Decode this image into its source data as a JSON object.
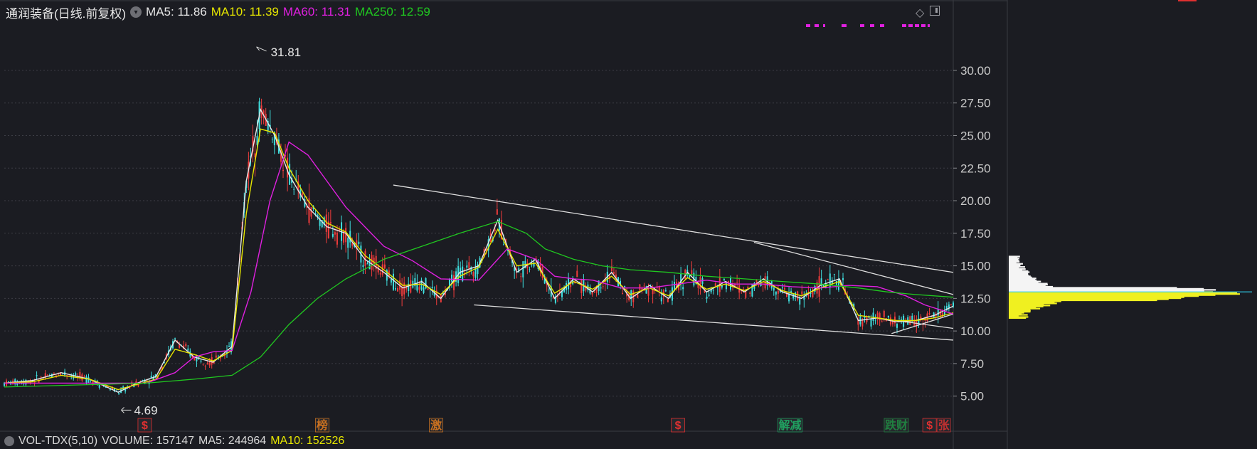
{
  "header": {
    "stock_name": "通润装备(日线.前复权)",
    "ma5": "MA5: 11.86",
    "ma10": "MA10: 11.39",
    "ma60": "MA60: 11.31",
    "ma250": "MA250: 12.59"
  },
  "volume_bar": {
    "label": "VOL-TDX(5,10)",
    "volume": "VOLUME: 157147",
    "ma5": "MA5: 244964",
    "ma10": "MA10: 152526"
  },
  "colors": {
    "background": "#1b1c22",
    "ma5": "#e8e8e8",
    "ma10": "#e6e600",
    "ma60": "#e020e0",
    "ma250": "#20c820",
    "up_candle": "#f03c3c",
    "down_candle": "#40e0e0"
  },
  "chart_data": {
    "type": "line",
    "title": "通润装备(日线.前复权)",
    "y_axis": {
      "ticks": [
        "30.00",
        "27.50",
        "25.00",
        "22.50",
        "20.00",
        "17.50",
        "15.00",
        "12.50",
        "10.00",
        "7.50",
        "5.00"
      ],
      "tick_values": [
        30,
        27.5,
        25,
        22.5,
        20,
        17.5,
        15,
        12.5,
        10,
        7.5,
        5
      ],
      "ylim": [
        4.0,
        33.0
      ],
      "position": "right",
      "grid": true
    },
    "annotations": [
      {
        "text": "31.81",
        "x": 0.2658,
        "value": 31.81,
        "kind": "high"
      },
      {
        "text": "4.69",
        "x": 0.1233,
        "value": 4.69,
        "kind": "low"
      }
    ],
    "x_range": [
      0,
      1
    ],
    "series": [
      {
        "name": "MA5",
        "color": "#e8e8e8",
        "x": [
          0,
          0.03,
          0.06,
          0.09,
          0.12,
          0.14,
          0.16,
          0.18,
          0.2,
          0.22,
          0.24,
          0.255,
          0.27,
          0.285,
          0.3,
          0.32,
          0.34,
          0.36,
          0.38,
          0.4,
          0.42,
          0.44,
          0.46,
          0.48,
          0.5,
          0.52,
          0.54,
          0.56,
          0.58,
          0.6,
          0.62,
          0.64,
          0.66,
          0.68,
          0.7,
          0.72,
          0.74,
          0.76,
          0.78,
          0.8,
          0.82,
          0.84,
          0.86,
          0.88,
          0.9,
          0.92,
          0.94,
          0.96,
          0.98,
          1.0
        ],
        "y": [
          6.0,
          6.2,
          6.8,
          6.3,
          5.3,
          6.0,
          6.5,
          9.3,
          8.0,
          7.6,
          8.8,
          21.5,
          27.0,
          25.0,
          22.0,
          19.5,
          18.0,
          17.5,
          15.5,
          14.5,
          13.3,
          13.8,
          12.5,
          14.5,
          15.0,
          18.5,
          14.5,
          15.5,
          12.5,
          14.0,
          13.0,
          14.5,
          12.5,
          13.5,
          12.5,
          14.5,
          13.0,
          13.8,
          13.0,
          14.0,
          13.0,
          12.5,
          13.5,
          14.0,
          10.8,
          11.0,
          10.7,
          10.8,
          11.2,
          11.9
        ]
      },
      {
        "name": "MA10",
        "color": "#e6e600",
        "x": [
          0,
          0.03,
          0.06,
          0.09,
          0.12,
          0.14,
          0.16,
          0.18,
          0.2,
          0.22,
          0.24,
          0.255,
          0.27,
          0.285,
          0.3,
          0.32,
          0.34,
          0.36,
          0.38,
          0.4,
          0.42,
          0.44,
          0.46,
          0.48,
          0.5,
          0.52,
          0.54,
          0.56,
          0.58,
          0.6,
          0.62,
          0.64,
          0.66,
          0.68,
          0.7,
          0.72,
          0.74,
          0.76,
          0.78,
          0.8,
          0.82,
          0.84,
          0.86,
          0.88,
          0.9,
          0.92,
          0.94,
          0.96,
          0.98,
          1.0
        ],
        "y": [
          6.0,
          6.1,
          6.6,
          6.3,
          5.5,
          5.9,
          6.3,
          8.6,
          8.2,
          7.7,
          8.5,
          19.0,
          25.5,
          25.2,
          22.5,
          20.0,
          18.3,
          17.6,
          15.8,
          14.7,
          13.5,
          13.6,
          12.8,
          14.2,
          14.9,
          17.8,
          15.0,
          15.2,
          12.9,
          13.8,
          13.2,
          14.2,
          12.8,
          13.3,
          12.7,
          14.1,
          13.2,
          13.6,
          13.1,
          13.8,
          13.1,
          12.7,
          13.3,
          13.8,
          11.2,
          11.0,
          10.8,
          10.8,
          11.0,
          11.4
        ]
      },
      {
        "name": "MA60",
        "color": "#e020e0",
        "x": [
          0,
          0.1,
          0.15,
          0.18,
          0.2,
          0.22,
          0.24,
          0.26,
          0.28,
          0.3,
          0.32,
          0.34,
          0.36,
          0.38,
          0.4,
          0.43,
          0.46,
          0.5,
          0.53,
          0.56,
          0.58,
          0.6,
          0.62,
          0.65,
          0.68,
          0.71,
          0.74,
          0.77,
          0.8,
          0.83,
          0.86,
          0.89,
          0.92,
          0.95,
          0.97,
          1.0
        ],
        "y": [
          6.0,
          6.0,
          6.0,
          6.8,
          8.0,
          8.4,
          8.5,
          13.0,
          20.0,
          24.5,
          23.5,
          21.5,
          19.5,
          18.0,
          16.5,
          15.4,
          14.0,
          13.9,
          16.3,
          15.5,
          14.2,
          14.0,
          13.9,
          13.3,
          13.3,
          13.6,
          13.9,
          13.6,
          13.6,
          13.4,
          13.3,
          13.5,
          13.4,
          12.7,
          12.0,
          11.31
        ]
      },
      {
        "name": "MA250",
        "color": "#20c820",
        "x": [
          0,
          0.1,
          0.15,
          0.2,
          0.24,
          0.27,
          0.3,
          0.33,
          0.36,
          0.4,
          0.44,
          0.48,
          0.52,
          0.55,
          0.57,
          0.6,
          0.63,
          0.66,
          0.7,
          0.74,
          0.78,
          0.82,
          0.86,
          0.9,
          0.93,
          0.96,
          1.0
        ],
        "y": [
          5.7,
          5.9,
          6.0,
          6.3,
          6.6,
          8.0,
          10.5,
          12.5,
          14.0,
          15.5,
          16.5,
          17.5,
          18.4,
          17.5,
          16.3,
          15.5,
          15.0,
          14.7,
          14.5,
          14.2,
          14.0,
          13.8,
          13.6,
          13.3,
          13.0,
          12.8,
          12.59
        ]
      }
    ]
  },
  "event_markers": [
    {
      "label": "$",
      "x": 0.148,
      "color": "#e03030"
    },
    {
      "label": "榜",
      "x": 0.335,
      "color": "#c87020"
    },
    {
      "label": "激",
      "x": 0.455,
      "color": "#c87020"
    },
    {
      "label": "$",
      "x": 0.71,
      "color": "#e03030"
    },
    {
      "label": "解减",
      "x": 0.828,
      "color": "#20a060"
    },
    {
      "label": "跌财",
      "x": 0.94,
      "color": "#208040"
    },
    {
      "label": "$",
      "x": 0.975,
      "color": "#e03030"
    },
    {
      "label": "张",
      "x": 0.99,
      "color": "#c03030"
    }
  ]
}
